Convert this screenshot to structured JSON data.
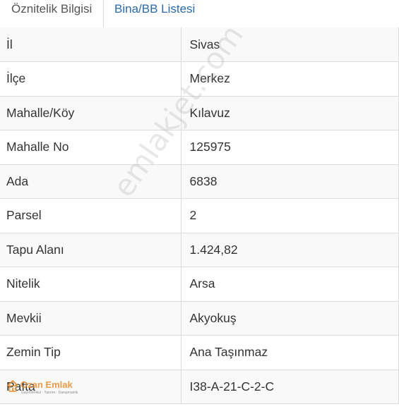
{
  "tabs": [
    {
      "label": "Öznitelik Bilgisi",
      "active": true
    },
    {
      "label": "Bina/BB Listesi",
      "active": false
    }
  ],
  "rows": [
    {
      "key": "İl",
      "value": "Sivas"
    },
    {
      "key": "İlçe",
      "value": "Merkez"
    },
    {
      "key": "Mahalle/Köy",
      "value": "Kılavuz"
    },
    {
      "key": "Mahalle No",
      "value": "125975"
    },
    {
      "key": "Ada",
      "value": "6838"
    },
    {
      "key": "Parsel",
      "value": "2"
    },
    {
      "key": "Tapu Alanı",
      "value": "1.424,82"
    },
    {
      "key": "Nitelik",
      "value": "Arsa"
    },
    {
      "key": "Mevkii",
      "value": "Akyokuş"
    },
    {
      "key": "Zemin Tip",
      "value": "Ana Taşınmaz"
    },
    {
      "key": "Pafta",
      "value": "I38-A-21-C-2-C"
    }
  ],
  "watermark": {
    "text": "emlakjet.com"
  },
  "logo": {
    "name": "Ozan Emlak",
    "tagline": "Gayrimenkul · Yatırım · Danışmanlık",
    "icon": "house-icon"
  },
  "colors": {
    "tab_link": "#2a6aa8",
    "stripe": "#f9f9f9",
    "border": "#dcdcdc",
    "logo": "#e88c28"
  }
}
